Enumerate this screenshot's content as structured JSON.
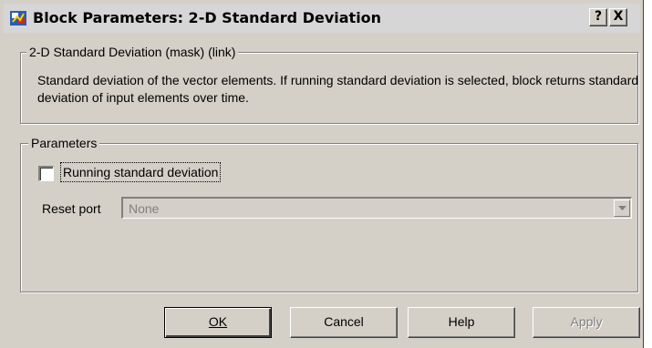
{
  "window": {
    "title": "Block Parameters: 2-D Standard Deviation",
    "help_button": "?",
    "close_button": "X"
  },
  "description_group": {
    "label": "2-D Standard Deviation (mask) (link)",
    "text": "Standard deviation of the vector elements. If running standard deviation is selected, block returns standard deviation of input elements over time."
  },
  "parameters_group": {
    "label": "Parameters",
    "running_checkbox": {
      "label": "Running standard deviation",
      "checked": false
    },
    "reset_port": {
      "label": "Reset port",
      "value": "None",
      "enabled": false
    }
  },
  "buttons": {
    "ok": "OK",
    "cancel": "Cancel",
    "help": "Help",
    "apply": "Apply"
  }
}
